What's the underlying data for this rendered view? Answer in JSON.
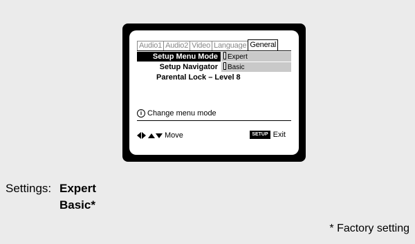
{
  "tabs": [
    {
      "label": "Audio1"
    },
    {
      "label": "Audio2"
    },
    {
      "label": "Video"
    },
    {
      "label": "Language"
    },
    {
      "label": "General"
    }
  ],
  "menu": {
    "rows": [
      {
        "label": "Setup Menu Mode",
        "value": "Expert"
      },
      {
        "label": "Setup Navigator",
        "value": "Basic"
      }
    ],
    "parental_lock": "Parental Lock – Level 8"
  },
  "hint": {
    "icon": "info-icon",
    "text": "Change menu mode"
  },
  "footer": {
    "move_label": "Move",
    "setup_key": "SETUP",
    "exit_label": "Exit"
  },
  "settings": {
    "label": "Settings:",
    "values": [
      "Expert",
      "Basic*"
    ]
  },
  "factory_note": "* Factory setting",
  "colors": {
    "background": "#ebebeb",
    "frame": "#000000",
    "selection_bg": "#000000",
    "option_bg": "#c9c9c9"
  }
}
